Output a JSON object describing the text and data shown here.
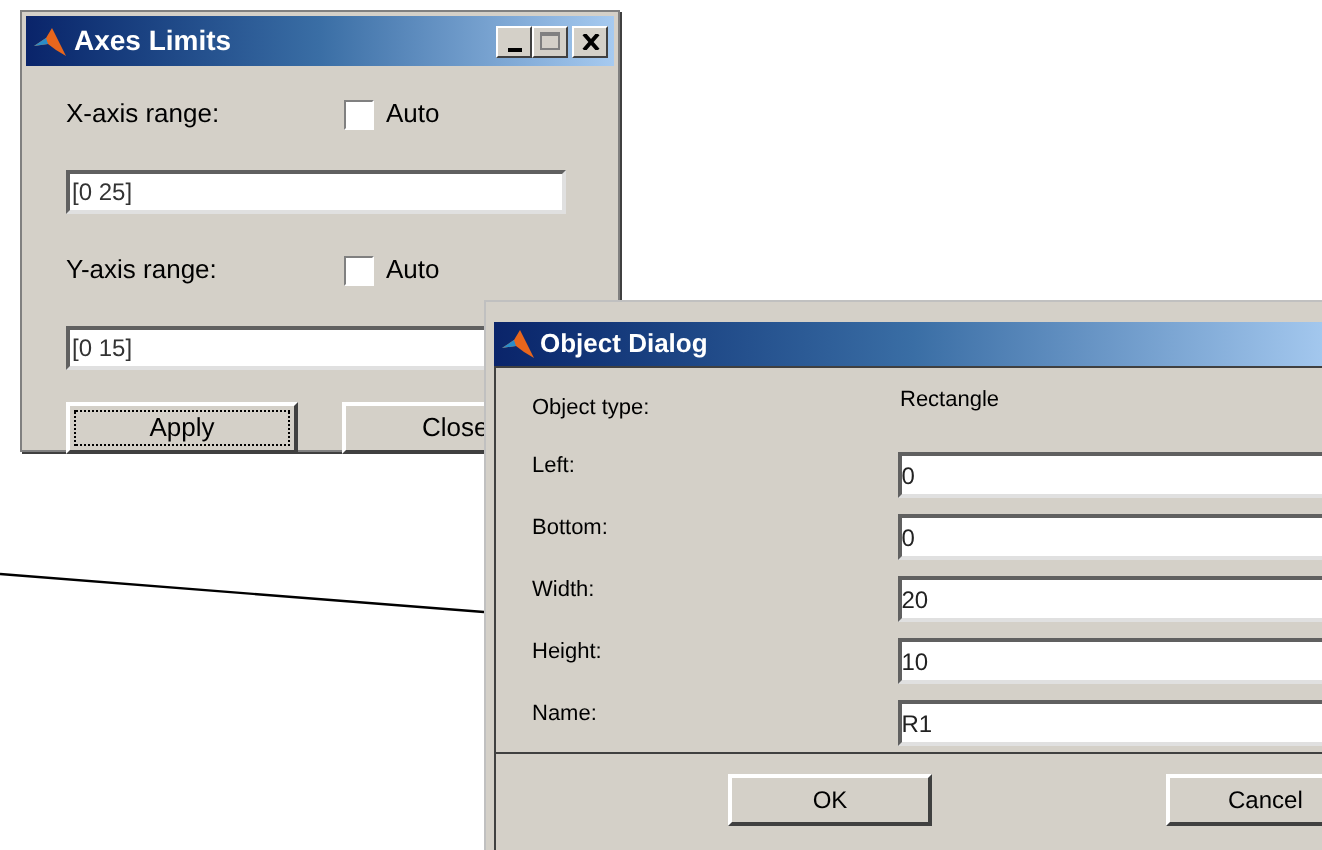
{
  "axes_limits": {
    "title": "Axes Limits",
    "ranges": [
      {
        "label": "X-axis range:",
        "auto_label": "Auto",
        "auto_checked": false,
        "value": "[0 25]"
      },
      {
        "label": "Y-axis range:",
        "auto_label": "Auto",
        "auto_checked": false,
        "value": "[0 15]"
      }
    ],
    "buttons": [
      {
        "label": "Apply",
        "focused": true
      },
      {
        "label": "Close",
        "focused": false
      }
    ]
  },
  "object_dialog": {
    "title": "Object Dialog",
    "type_label": "Object type:",
    "type_value": "Rectangle",
    "fields": [
      {
        "label": "Left:",
        "value": "0"
      },
      {
        "label": "Bottom:",
        "value": "0"
      },
      {
        "label": "Width:",
        "value": "20"
      },
      {
        "label": "Height:",
        "value": "10"
      },
      {
        "label": "Name:",
        "value": "R1"
      }
    ],
    "buttons": [
      {
        "label": "OK",
        "focused": false
      },
      {
        "label": "Cancel",
        "focused": false
      }
    ]
  }
}
